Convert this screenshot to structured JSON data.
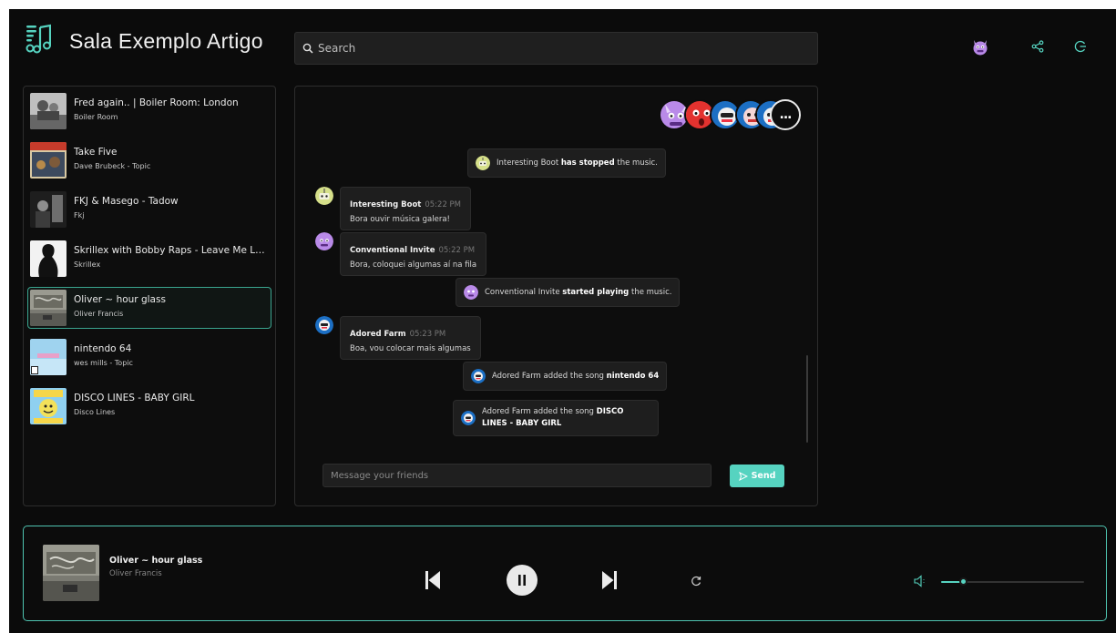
{
  "header": {
    "title": "Sala Exemplo Artigo",
    "search_placeholder": "Search"
  },
  "colors": {
    "accent": "#56d3c0",
    "border_active": "#3aa58f",
    "background": "#0b0b0b"
  },
  "icons": {
    "logo": "music-notes-logo-icon",
    "search": "search-icon",
    "share": "share-icon",
    "logout": "logout-icon",
    "user": "monster-avatar-icon"
  },
  "queue": {
    "items": [
      {
        "title": "Fred again.. | Boiler Room: London",
        "artist": "Boiler Room"
      },
      {
        "title": "Take Five",
        "artist": "Dave Brubeck - Topic"
      },
      {
        "title": "FKJ & Masego - Tadow",
        "artist": "Fkj"
      },
      {
        "title": "Skrillex with Bobby Raps - Leave Me Like T...",
        "artist": "Skrillex"
      },
      {
        "title": "Oliver ~ hour glass",
        "artist": "Oliver Francis"
      },
      {
        "title": "nintendo 64",
        "artist": "wes mills - Topic"
      },
      {
        "title": "DISCO LINES - BABY GIRL",
        "artist": "Disco Lines"
      }
    ],
    "active_index": 4
  },
  "chat": {
    "more_label": "...",
    "events": [
      {
        "actor": "Interesting Boot",
        "action": "has stopped",
        "suffix": "the music."
      },
      {
        "actor": "Conventional Invite",
        "action": "started playing",
        "suffix": "the music."
      },
      {
        "actor": "Adored Farm",
        "action": "added the song",
        "song": "nintendo 64"
      },
      {
        "actor": "Adored Farm",
        "action": "added the song",
        "song": "DISCO LINES - BABY GIRL"
      }
    ],
    "messages": [
      {
        "author": "Interesting Boot",
        "time": "05:22 PM",
        "text": "Bora ouvir música galera!"
      },
      {
        "author": "Conventional Invite",
        "time": "05:22 PM",
        "text": "Bora, coloquei algumas aí na fila"
      },
      {
        "author": "Adored Farm",
        "time": "05:23 PM",
        "text": "Boa, vou colocar mais algumas"
      }
    ],
    "input_placeholder": "Message your friends",
    "send_label": "Send"
  },
  "player": {
    "title": "Oliver ~ hour glass",
    "artist": "Oliver Francis",
    "volume": 0.15
  }
}
